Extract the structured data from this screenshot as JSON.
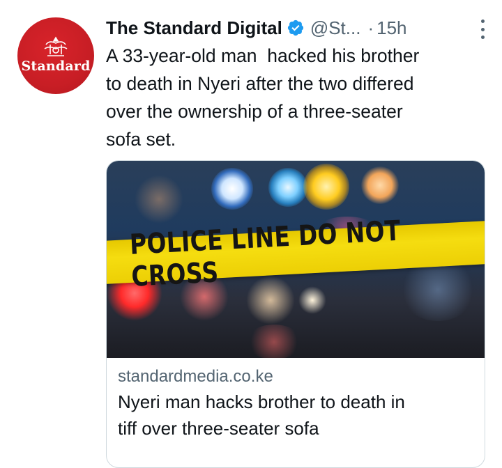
{
  "account": {
    "avatar_text": "Standard",
    "display_name": "The Standard Digital",
    "handle": "@St...",
    "separator": "·",
    "time": "15h"
  },
  "tweet": {
    "text": "A 33-year-old man  hacked his brother\nto death in Nyeri after the two differed\nover the ownership of a three-seater\nsofa set."
  },
  "card": {
    "image_text": "POLICE LINE DO NOT CROSS",
    "domain": "standardmedia.co.ke",
    "title": "Nyeri man hacks brother to death in\ntiff over three-seater sofa"
  },
  "icons": {
    "verified": "verified-badge-icon",
    "more": "more-options-icon"
  },
  "colors": {
    "avatar_bg": "#c81e25",
    "verified_blue": "#1d9bf0",
    "muted_text": "#536471",
    "tape_yellow": "#f0d50a"
  }
}
